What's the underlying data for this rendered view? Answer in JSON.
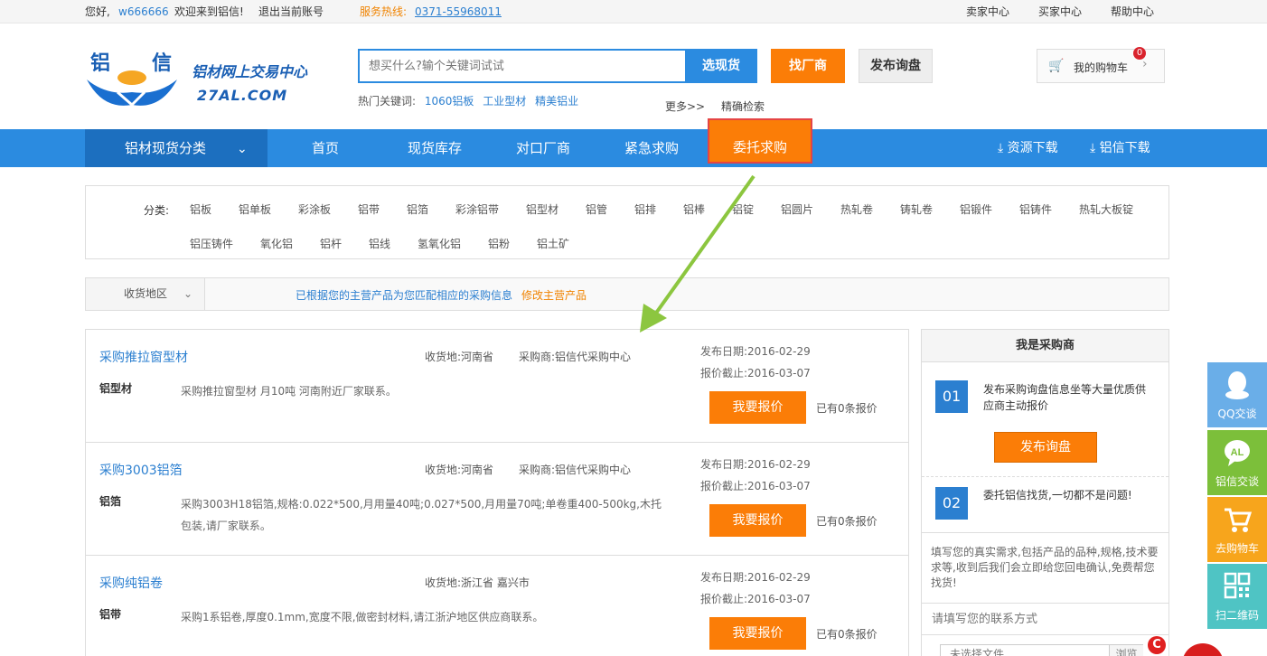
{
  "topbar": {
    "greeting": "您好,",
    "username": "w666666",
    "welcome": "欢迎来到铝信!",
    "logout": "退出当前账号",
    "hotline_label": "服务热线:",
    "hotline_number": "0371-55968011",
    "seller_center": "卖家中心",
    "buyer_center": "买家中心",
    "help_center": "帮助中心"
  },
  "logo": {
    "char1": "铝",
    "char2": "信",
    "subtitle": "铝材网上交易中心",
    "domain": "27AL.COM"
  },
  "search": {
    "placeholder": "想买什么?输个关键词试试",
    "btn_spot": "选现货",
    "btn_factory": "找厂商",
    "btn_inquiry": "发布询盘",
    "hot_label": "热门关键词:",
    "hot_keywords": [
      "1060铝板",
      "工业型材",
      "精美铝业"
    ],
    "more": "更多>>",
    "exact": "精确检索"
  },
  "cart": {
    "label": "我的购物车",
    "count": "0"
  },
  "nav": {
    "category": "铝材现货分类",
    "items": [
      "首页",
      "现货库存",
      "对口厂商",
      "紧急求购",
      "委托求购"
    ],
    "download_resources": "资源下载",
    "download_app": "铝信下载"
  },
  "categories": {
    "label": "分类:",
    "row1": [
      "铝板",
      "铝单板",
      "彩涂板",
      "铝带",
      "铝箔",
      "彩涂铝带",
      "铝型材",
      "铝管",
      "铝排",
      "铝棒",
      "铝锭",
      "铝圆片",
      "热轧卷",
      "铸轧卷",
      "铝锻件",
      "铝铸件",
      "热轧大板锭"
    ],
    "row2": [
      "铝压铸件",
      "氧化铝",
      "铝杆",
      "铝线",
      "氢氧化铝",
      "铝粉",
      "铝土矿"
    ]
  },
  "filter": {
    "region": "收货地区",
    "message": "已根据您的主营产品为您匹配相应的采购信息",
    "modify": "修改主营产品"
  },
  "listings": [
    {
      "title": "采购推拉窗型材",
      "location": "收货地:河南省",
      "buyer": "采购商:铝信代采购中心",
      "material": "铝型材",
      "description": "采购推拉窗型材 月10吨 河南附近厂家联系。",
      "published": "发布日期:2016-02-29",
      "deadline": "报价截止:2016-03-07",
      "quote_btn": "我要报价",
      "quote_count": "已有0条报价"
    },
    {
      "title": "采购3003铝箔",
      "location": "收货地:河南省",
      "buyer": "采购商:铝信代采购中心",
      "material": "铝箔",
      "description": "采购3003H18铝箔,规格:0.022*500,月用量40吨;0.027*500,月用量70吨;单卷重400-500kg,木托包装,请厂家联系。",
      "published": "发布日期:2016-02-29",
      "deadline": "报价截止:2016-03-07",
      "quote_btn": "我要报价",
      "quote_count": "已有0条报价"
    },
    {
      "title": "采购纯铝卷",
      "location": "收货地:浙江省 嘉兴市",
      "buyer": "",
      "material": "铝带",
      "description": "采购1系铝卷,厚度0.1mm,宽度不限,做密封材料,请江浙沪地区供应商联系。",
      "published": "发布日期:2016-02-29",
      "deadline": "报价截止:2016-03-07",
      "quote_btn": "我要报价",
      "quote_count": "已有0条报价"
    }
  ],
  "panel": {
    "title": "我是采购商",
    "step1_num": "01",
    "step1_text": "发布采购询盘信息坐等大量优质供应商主动报价",
    "step1_btn": "发布询盘",
    "step2_num": "02",
    "step2_text": "委托铝信找货,一切都不是问题!",
    "note": "填写您的真实需求,包括产品的品种,规格,技术要求等,收到后我们会立即给您回电确认,免费帮您找货!",
    "contact_placeholder": "请填写您的联系方式",
    "file_placeholder": "未选择文件",
    "browse": "浏览"
  },
  "side_tools": {
    "qq": "QQ交谈",
    "chat": "铝信交谈",
    "cart": "去购物车",
    "qr": "扫二维码"
  },
  "colors": {
    "primary_blue": "#2b8be0",
    "orange": "#fb7d07",
    "highlight_red": "#e54545",
    "arrow_green": "#8cc63f"
  }
}
